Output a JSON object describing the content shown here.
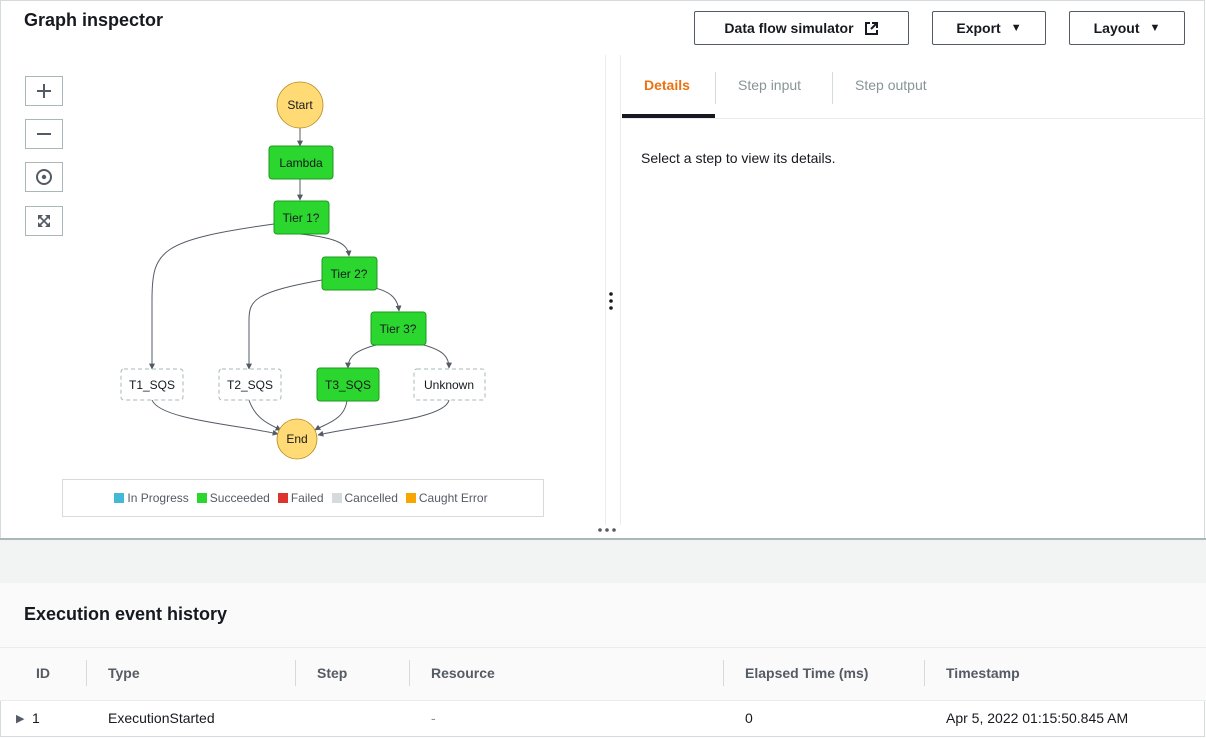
{
  "header": {
    "title": "Graph inspector",
    "simulator_label": "Data flow simulator",
    "export_label": "Export",
    "layout_label": "Layout"
  },
  "graph": {
    "nodes": {
      "start": "Start",
      "lambda": "Lambda",
      "tier1": "Tier 1?",
      "tier2": "Tier 2?",
      "tier3": "Tier 3?",
      "t1": "T1_SQS",
      "t2": "T2_SQS",
      "t3": "T3_SQS",
      "unknown": "Unknown",
      "end": "End"
    },
    "legend": [
      {
        "label": "In Progress",
        "color": "#44b9d6"
      },
      {
        "label": "Succeeded",
        "color": "#2bd62e"
      },
      {
        "label": "Failed",
        "color": "#de322f"
      },
      {
        "label": "Cancelled",
        "color": "#d5dbdb"
      },
      {
        "label": "Caught Error",
        "color": "#f7a500"
      }
    ]
  },
  "details": {
    "tabs": [
      "Details",
      "Step input",
      "Step output"
    ],
    "message": "Select a step to view its details."
  },
  "history": {
    "title": "Execution event history",
    "columns": [
      "ID",
      "Type",
      "Step",
      "Resource",
      "Elapsed Time (ms)",
      "Timestamp"
    ],
    "rows": [
      {
        "id": "1",
        "type": "ExecutionStarted",
        "step": "",
        "resource": "-",
        "elapsed": "0",
        "timestamp": "Apr 5, 2022 01:15:50.845 AM"
      }
    ]
  },
  "colors": {
    "succeeded": "#2bd62e",
    "terminal": "#ffda75",
    "accent": "#ec7211"
  }
}
